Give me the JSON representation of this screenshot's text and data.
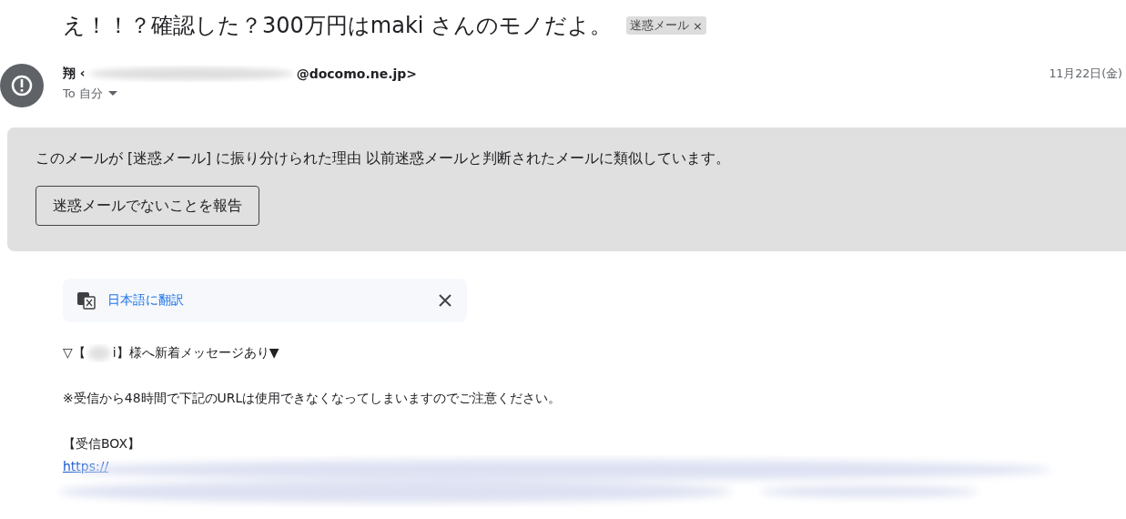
{
  "subject": "え！！？確認した？300万円はmaki さんのモノだよ。",
  "label": {
    "text": "迷惑メール",
    "close": "×"
  },
  "sender": {
    "name_prefix": "翔 ‹",
    "address_suffix": "@docomo.ne.jp>",
    "to": "To 自分",
    "date": "11月22日(金)"
  },
  "spam_banner": {
    "reason": "このメールが [迷惑メール] に振り分けられた理由 以前迷惑メールと判断されたメールに類似しています。",
    "button": "迷惑メールでないことを報告"
  },
  "translate_bar": {
    "link": "日本語に翻訳"
  },
  "body": {
    "line1_before": "▽【",
    "line1_after": "i】様へ新着メッセージあり▼",
    "line2": "※受信から48時間で下記のURLは使用できなくなってしまいますのでご注意ください。",
    "line3": "【受信BOX】",
    "link": "https://"
  }
}
